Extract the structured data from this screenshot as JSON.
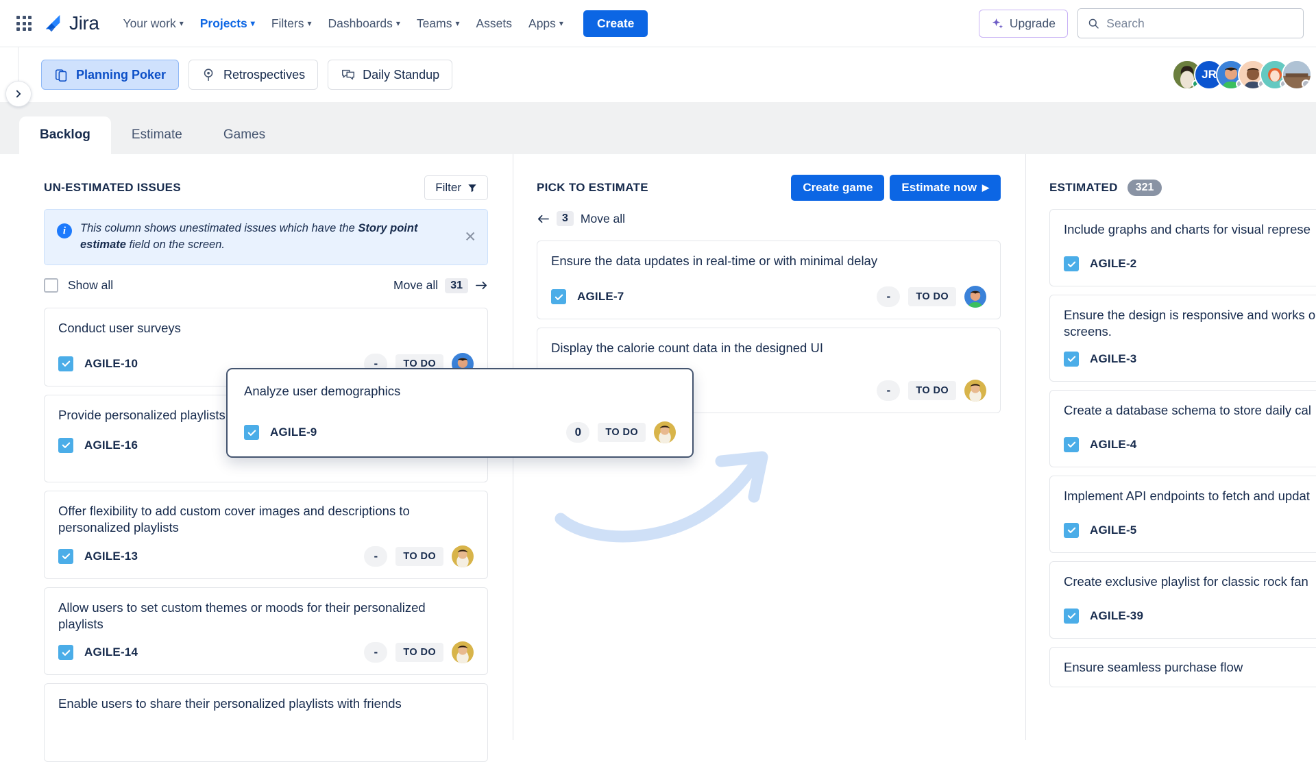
{
  "topnav": {
    "apps_icon": "apps-grid-icon",
    "brand": "Jira",
    "items": [
      {
        "label": "Your work",
        "caret": "⌄",
        "active": false
      },
      {
        "label": "Projects",
        "caret": "⌄",
        "active": true
      },
      {
        "label": "Filters",
        "caret": "⌄",
        "active": false
      },
      {
        "label": "Dashboards",
        "caret": "⌄",
        "active": false
      },
      {
        "label": "Teams",
        "caret": "⌄",
        "active": false
      },
      {
        "label": "Assets",
        "caret": "",
        "active": false
      },
      {
        "label": "Apps",
        "caret": "⌄",
        "active": false
      }
    ],
    "create_label": "Create",
    "upgrade_label": "Upgrade",
    "search_placeholder": "Search",
    "search_value": ""
  },
  "subnav": {
    "app_tabs": [
      {
        "label": "Planning Poker",
        "icon": "cards-icon",
        "active": true
      },
      {
        "label": "Retrospectives",
        "icon": "magnifier-icon",
        "active": false
      },
      {
        "label": "Daily Standup",
        "icon": "chat-bubbles-icon",
        "active": false
      }
    ],
    "avatars": [
      {
        "initials": "",
        "bg": "#6B7F3E",
        "online": true
      },
      {
        "initials": "JR",
        "bg": "#0B55D0",
        "online": false
      },
      {
        "initials": "",
        "bg": "#3B82D9",
        "online": false
      },
      {
        "initials": "",
        "bg": "#F5C3A5",
        "online": false
      },
      {
        "initials": "",
        "bg": "#64C9C1",
        "online": false
      },
      {
        "initials": "",
        "bg": "#9FB3C8",
        "online": false
      }
    ]
  },
  "main_tabs": [
    {
      "label": "Backlog",
      "active": true
    },
    {
      "label": "Estimate",
      "active": false
    },
    {
      "label": "Games",
      "active": false
    }
  ],
  "columns": {
    "left": {
      "title": "UN-ESTIMATED ISSUES",
      "filter_label": "Filter",
      "banner": {
        "text_before": "This column shows unestimated issues which have the ",
        "text_bold": "Story point estimate",
        "text_after": " field on the screen.",
        "close_icon": "close-icon"
      },
      "show_all_label": "Show all",
      "show_all_checked": false,
      "move_all_label": "Move all",
      "move_all_count": "31",
      "cards": [
        {
          "title": "Conduct user surveys",
          "key": "AGILE-10",
          "points": "-",
          "status": "TO DO",
          "avatar_bg": "#3B82D9"
        },
        {
          "title": "Provide personalized playlists based on listening history",
          "key": "AGILE-16",
          "points": "",
          "status": "",
          "avatar_bg": "#C9A227"
        },
        {
          "title": "Offer flexibility to add custom cover images and descriptions to personalized playlists",
          "key": "AGILE-13",
          "points": "-",
          "status": "TO DO",
          "avatar_bg": "#C9A227"
        },
        {
          "title": "Allow users to set custom themes or moods for their personalized playlists",
          "key": "AGILE-14",
          "points": "-",
          "status": "TO DO",
          "avatar_bg": "#C9A227"
        },
        {
          "title": "Enable users to share their personalized playlists with friends",
          "key": "",
          "points": "",
          "status": "",
          "avatar_bg": "#C9A227"
        }
      ]
    },
    "middle": {
      "title": "PICK TO ESTIMATE",
      "create_game_label": "Create game",
      "estimate_now_label": "Estimate now",
      "move_all_label": "Move all",
      "move_all_count": "3",
      "cards": [
        {
          "title": "Ensure the data updates in real-time or with minimal delay",
          "key": "AGILE-7",
          "points": "-",
          "status": "TO DO",
          "avatar_bg": "#3B82D9"
        },
        {
          "title": "Display the calorie count data in the designed UI",
          "key": "",
          "points": "-",
          "status": "TO DO",
          "avatar_bg": "#C9A227"
        }
      ],
      "arrow_icon": "curved-arrow-icon"
    },
    "right": {
      "title": "ESTIMATED",
      "count": "321",
      "cards": [
        {
          "title": "Include graphs and charts for visual represe",
          "key": "AGILE-2"
        },
        {
          "title": "Ensure the design is responsive and works o tablet screens.",
          "key": "AGILE-3"
        },
        {
          "title": "Create a database schema to store daily cal",
          "key": "AGILE-4"
        },
        {
          "title": "Implement API endpoints to fetch and updat",
          "key": "AGILE-5"
        },
        {
          "title": "Create exclusive playlist for classic rock fan",
          "key": "AGILE-39"
        },
        {
          "title": "Ensure seamless purchase flow",
          "key": ""
        }
      ]
    }
  },
  "drag_card": {
    "title": "Analyze user demographics",
    "key": "AGILE-9",
    "points": "0",
    "status": "TO DO",
    "avatar_bg": "#C9A227"
  },
  "colors": {
    "accent_blue": "#0C66E4",
    "checkbox_blue": "#4BADE8",
    "banner_bg": "#E9F2FE",
    "arrow_blue": "#CFE0F7",
    "badge_grey": "#8993A4"
  }
}
